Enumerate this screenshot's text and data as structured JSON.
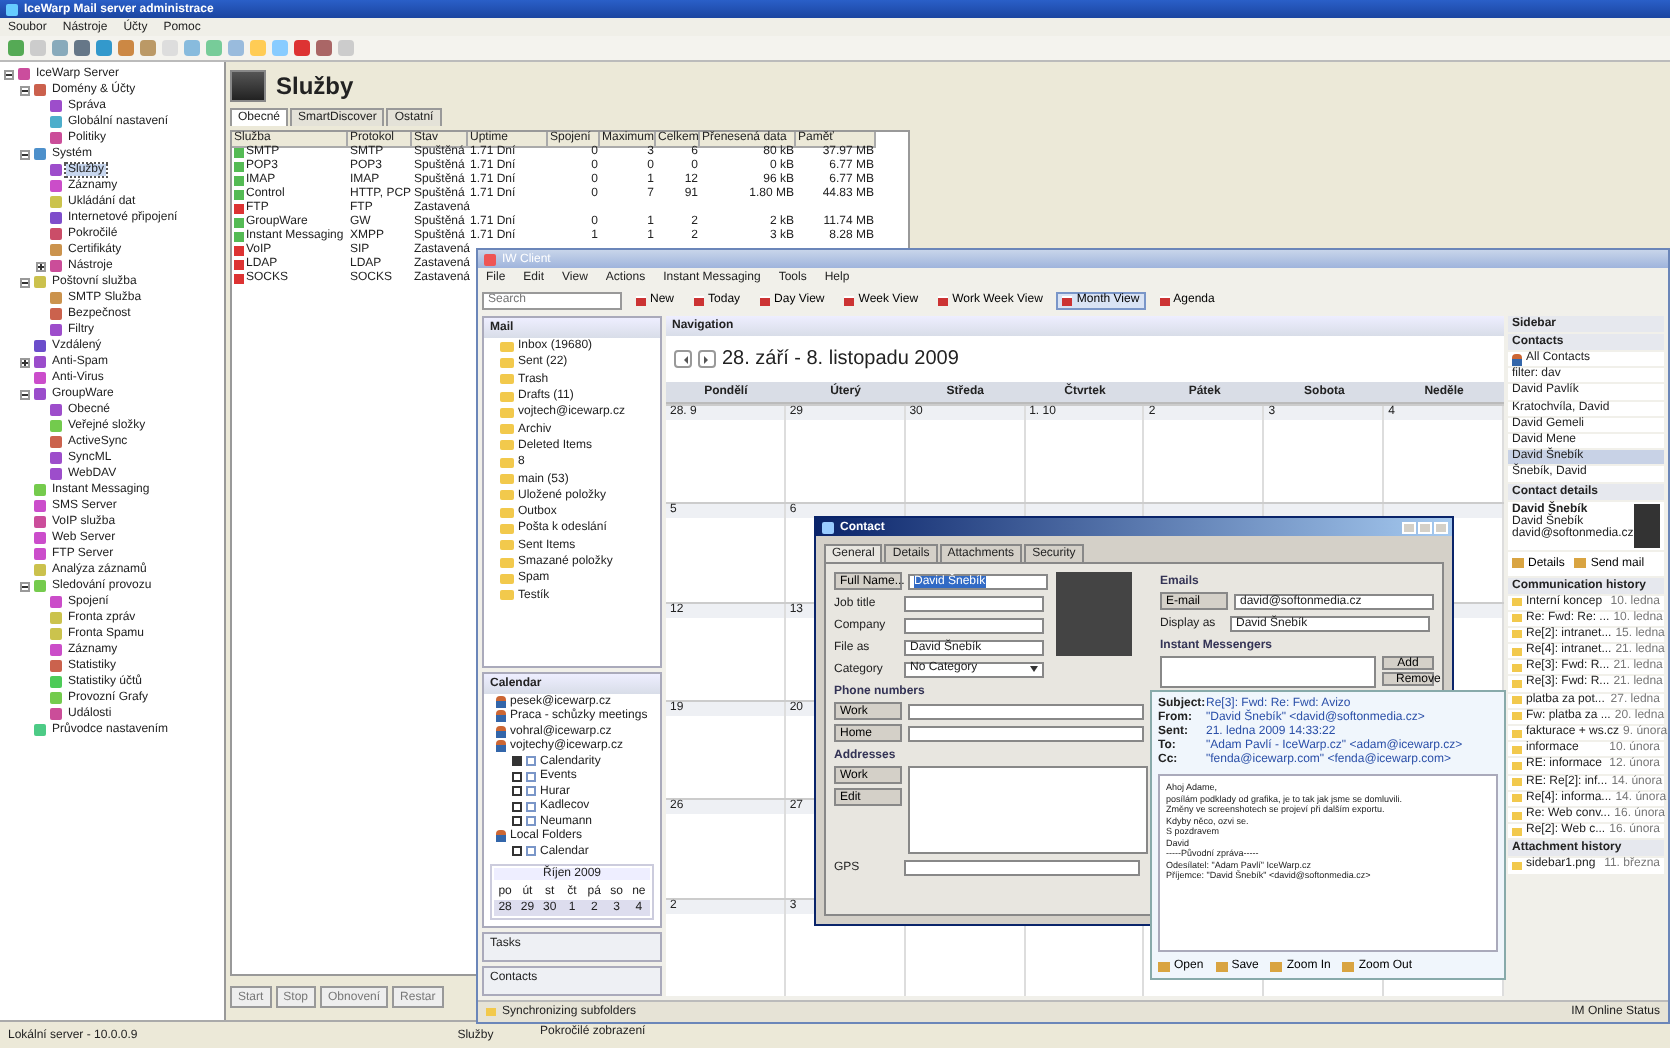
{
  "admin": {
    "title": "IceWarp Mail server administrace",
    "menu": [
      "Soubor",
      "Nástroje",
      "Účty",
      "Pomoc"
    ],
    "tree": [
      {
        "label": "IceWarp Server",
        "selected": false,
        "expanded": true,
        "children": [
          {
            "label": "Domény & Účty",
            "selected": false,
            "expanded": true,
            "children": [
              {
                "label": "Správa",
                "selected": false
              },
              {
                "label": "Globální nastavení",
                "selected": false
              },
              {
                "label": "Politiky",
                "selected": false
              }
            ]
          },
          {
            "label": "Systém",
            "selected": false,
            "expanded": true,
            "children": [
              {
                "label": "Služby",
                "selected": true
              },
              {
                "label": "Záznamy",
                "selected": false
              },
              {
                "label": "Ukládání dat",
                "selected": false
              },
              {
                "label": "Internetové připojení",
                "selected": false
              },
              {
                "label": "Pokročilé",
                "selected": false
              },
              {
                "label": "Certifikáty",
                "selected": false
              },
              {
                "label": "Nástroje",
                "selected": false,
                "expanded": false
              }
            ]
          },
          {
            "label": "Poštovní služba",
            "selected": false,
            "expanded": true,
            "children": [
              {
                "label": "SMTP Služba",
                "selected": false
              },
              {
                "label": "Bezpečnost",
                "selected": false
              },
              {
                "label": "Filtry",
                "selected": false
              }
            ]
          },
          {
            "label": "Vzdálený",
            "selected": false
          },
          {
            "label": "Anti-Spam",
            "selected": false,
            "expanded": false
          },
          {
            "label": "Anti-Virus",
            "selected": false
          },
          {
            "label": "GroupWare",
            "selected": false,
            "expanded": true,
            "children": [
              {
                "label": "Obecné",
                "selected": false
              },
              {
                "label": "Veřejné složky",
                "selected": false
              },
              {
                "label": "ActiveSync",
                "selected": false
              },
              {
                "label": "SyncML",
                "selected": false
              },
              {
                "label": "WebDAV",
                "selected": false
              }
            ]
          },
          {
            "label": "Instant Messaging",
            "selected": false
          },
          {
            "label": "SMS Server",
            "selected": false
          },
          {
            "label": "VoIP služba",
            "selected": false
          },
          {
            "label": "Web Server",
            "selected": false
          },
          {
            "label": "FTP Server",
            "selected": false
          },
          {
            "label": "Analýza záznamů",
            "selected": false
          },
          {
            "label": "Sledování provozu",
            "selected": false,
            "expanded": true,
            "children": [
              {
                "label": "Spojení",
                "selected": false
              },
              {
                "label": "Fronta zpráv",
                "selected": false
              },
              {
                "label": "Fronta Spamu",
                "selected": false
              },
              {
                "label": "Záznamy",
                "selected": false
              },
              {
                "label": "Statistiky",
                "selected": false
              },
              {
                "label": "Statistiky účtů",
                "selected": false
              },
              {
                "label": "Provozní Grafy",
                "selected": false
              },
              {
                "label": "Události",
                "selected": false
              }
            ]
          },
          {
            "label": "Průvodce nastavením",
            "selected": false
          }
        ]
      }
    ],
    "header": "Služby",
    "tabs": [
      {
        "label": "Obecné",
        "selected": true
      },
      {
        "label": "SmartDiscover",
        "selected": false
      },
      {
        "label": "Ostatní",
        "selected": false
      }
    ],
    "table": {
      "columns": [
        "Služba",
        "Protokol",
        "Stav",
        "Uptime",
        "Spojení",
        "Maximum",
        "Celkem",
        "Přenesená data",
        "Paměť"
      ],
      "rows": [
        {
          "running": true,
          "cells": [
            "SMTP",
            "SMTP",
            "Spuštěná",
            "1.71 Dní",
            "0",
            "3",
            "6",
            "80 kB",
            "37.97 MB"
          ]
        },
        {
          "running": true,
          "cells": [
            "POP3",
            "POP3",
            "Spuštěná",
            "1.71 Dní",
            "0",
            "0",
            "0",
            "0 kB",
            "6.77 MB"
          ]
        },
        {
          "running": true,
          "cells": [
            "IMAP",
            "IMAP",
            "Spuštěná",
            "1.71 Dní",
            "0",
            "1",
            "12",
            "96 kB",
            "6.77 MB"
          ]
        },
        {
          "running": true,
          "cells": [
            "Control",
            "HTTP, PCP",
            "Spuštěná",
            "1.71 Dní",
            "0",
            "7",
            "91",
            "1.80 MB",
            "44.83 MB"
          ]
        },
        {
          "running": false,
          "cells": [
            "FTP",
            "FTP",
            "Zastavená"
          ]
        },
        {
          "running": true,
          "cells": [
            "GroupWare",
            "GW",
            "Spuštěná",
            "1.71 Dní",
            "0",
            "1",
            "2",
            "2 kB",
            "11.74 MB"
          ]
        },
        {
          "running": true,
          "cells": [
            "Instant Messaging",
            "XMPP",
            "Spuštěná",
            "1.71 Dní",
            "1",
            "1",
            "2",
            "3 kB",
            "8.28 MB"
          ]
        },
        {
          "running": false,
          "cells": [
            "VoIP",
            "SIP",
            "Zastavená"
          ]
        },
        {
          "running": false,
          "cells": [
            "LDAP",
            "LDAP",
            "Zastavená"
          ]
        },
        {
          "running": false,
          "cells": [
            "SOCKS",
            "SOCKS",
            "Zastavená"
          ]
        }
      ]
    },
    "buttons": [
      "Start",
      "Stop",
      "Obnovení",
      "Restar"
    ],
    "status_bar": [
      "Lokální server - 10.0.0.9",
      "Služby"
    ]
  },
  "client": {
    "title": "IW Client",
    "menu": [
      "File",
      "Edit",
      "View",
      "Actions",
      "Instant Messaging",
      "Tools",
      "Help"
    ],
    "search": {
      "placeholder": "Search"
    },
    "toolbar": [
      {
        "label": "New",
        "selected": false
      },
      {
        "label": "Today",
        "selected": false
      },
      {
        "label": "Day View",
        "selected": false
      },
      {
        "label": "Week View",
        "selected": false
      },
      {
        "label": "Work Week View",
        "selected": false
      },
      {
        "label": "Month View",
        "selected": true
      },
      {
        "label": "Agenda",
        "selected": false
      }
    ],
    "mail": {
      "title": "Mail",
      "folders": [
        "Inbox (19680)",
        "Sent (22)",
        "Trash",
        "Drafts (11)",
        "vojtech@icewarp.cz",
        "Archiv",
        "Deleted Items",
        "8",
        "main (53)",
        "Uložené položky",
        "Outbox",
        "Pošta k odeslání",
        "Sent Items",
        "Smazané položky",
        "Spam",
        "Testík"
      ]
    },
    "calendar": {
      "title": "Calendar",
      "items": [
        {
          "kind": "account",
          "label": "pesek@icewarp.cz"
        },
        {
          "kind": "account",
          "label": "Praca - schůzky meetings"
        },
        {
          "kind": "account",
          "label": "vohral@icewarp.cz"
        },
        {
          "kind": "account",
          "label": "vojtechy@icewarp.cz"
        },
        {
          "kind": "calendar",
          "label": "Calendarity",
          "checked": true
        },
        {
          "kind": "calendar",
          "label": "Events",
          "checked": false
        },
        {
          "kind": "calendar",
          "label": "Hurar",
          "checked": false
        },
        {
          "kind": "calendar",
          "label": "Kadlecov",
          "checked": false
        },
        {
          "kind": "calendar",
          "label": "Neumann",
          "checked": false
        },
        {
          "kind": "account",
          "label": "Local Folders"
        },
        {
          "kind": "calendar",
          "label": "Calendar",
          "checked": false
        }
      ],
      "month": "Říjen 2009",
      "weekdays": [
        "po",
        "út",
        "st",
        "čt",
        "pá",
        "so",
        "ne"
      ],
      "days": [
        "28",
        "29",
        "30",
        "1",
        "2",
        "3",
        "4"
      ]
    },
    "panes": [
      "Tasks",
      "Contacts"
    ],
    "status": "Synchronizing subfolders",
    "status_right": "IM Online Status",
    "bottom_note": "Pokročilé zobrazení",
    "navigation": {
      "title": "Navigation",
      "range": "28. září - 8. listopadu 2009",
      "weekdays": [
        "Pondělí",
        "Úterý",
        "Středa",
        "Čtvrtek",
        "Pátek",
        "Sobota",
        "Neděle"
      ],
      "weeks": [
        [
          "28. 9",
          "29",
          "30",
          "1. 10",
          "2",
          "3",
          "4"
        ],
        [
          "5",
          "6"
        ],
        [
          "12",
          "13"
        ],
        [
          "19",
          "20"
        ],
        [
          "26",
          "27"
        ],
        [
          "2",
          "3"
        ]
      ]
    },
    "sidebar": {
      "title": "Sidebar",
      "contacts_title": "Contacts",
      "all_contacts": "All Contacts",
      "filter": "filter: dav",
      "contacts": [
        {
          "label": "David Pavlík",
          "selected": false
        },
        {
          "label": "Kratochvíla, David",
          "selected": false
        },
        {
          "label": "David Gemeli",
          "selected": false
        },
        {
          "label": "David Mene",
          "selected": false
        },
        {
          "label": "David Šnebík",
          "selected": true
        },
        {
          "label": "Šnebík, David",
          "selected": false
        }
      ],
      "details_title": "Contact details",
      "details": [
        "David Šnebík",
        "David Šnebík",
        "david@softonmedia.cz"
      ],
      "detail_buttons": [
        "Details",
        "Send mail"
      ],
      "history_title": "Communication history",
      "history": [
        [
          "Interní koncep",
          "10. ledna"
        ],
        [
          "Re: Fwd: Re: ...",
          "10. ledna"
        ],
        [
          "Re[2]: intranet...",
          "15. ledna"
        ],
        [
          "Re[4]: intranet...",
          "21. ledna"
        ],
        [
          "Re[3]: Fwd: R...",
          "21. ledna"
        ],
        [
          "Re[3]: Fwd: R...",
          "21. ledna"
        ],
        [
          "platba za pot...",
          "27. ledna"
        ],
        [
          "Fw: platba za ...",
          "20. ledna"
        ],
        [
          "fakturace + ws.cz",
          "9. února"
        ],
        [
          "informace",
          "10. února"
        ],
        [
          "RE: informace",
          "12. února"
        ],
        [
          "RE: Re[2]: inf...",
          "14. února"
        ],
        [
          "Re[4]: informa...",
          "14. února"
        ],
        [
          "Re: Web conv...",
          "16. února"
        ],
        [
          "Re[2]: Web c...",
          "16. února"
        ]
      ],
      "attachments_title": "Attachment history",
      "attachments": [
        [
          "sidebar1.png",
          "11. března"
        ]
      ]
    }
  },
  "contact": {
    "title": "Contact",
    "tabs": [
      {
        "label": "General",
        "selected": true
      },
      {
        "label": "Details",
        "selected": false
      },
      {
        "label": "Attachments",
        "selected": false
      },
      {
        "label": "Security",
        "selected": false
      }
    ],
    "fields": [
      {
        "kind": "button",
        "label": "Full Name...",
        "value": "David Šnebík"
      },
      {
        "kind": "text",
        "label": "Job title"
      },
      {
        "kind": "text",
        "label": "Company"
      },
      {
        "kind": "text",
        "label": "File as",
        "value": "David Šnebík"
      },
      {
        "kind": "select",
        "label": "Category",
        "value": "No Category"
      }
    ],
    "phone_title": "Phone numbers",
    "phones": [
      "Work",
      "Home"
    ],
    "address_title": "Addresses",
    "address_buttons": [
      "Work",
      "Edit"
    ],
    "gps": "GPS",
    "emails_title": "Emails",
    "email_button": "E-mail",
    "email": "david@softonmedia.cz",
    "display_label": "Display as",
    "display": "David Šnebík",
    "im_title": "Instant Messengers",
    "im_buttons": [
      "Add",
      "Remove"
    ]
  },
  "preview": {
    "headers": [
      [
        "Subject:",
        "Re[3]: Fwd: Re: Fwd: Avizo"
      ],
      [
        "From:",
        "\"David Šnebík\" <david@softonmedia.cz>"
      ],
      [
        "Sent:",
        "21. ledna 2009 14:33:22"
      ],
      [
        "To:",
        "\"Adam Pavlí - IceWarp.cz\" <adam@icewarp.cz>"
      ],
      [
        "Cc:",
        "\"fenda@icewarp.com\" <fenda@icewarp.com>"
      ]
    ],
    "body": [
      "Ahoj Adame,",
      "posílám podklady od grafika, je to tak jak jsme se domluvili.",
      "Změny ve screenshotech se projeví při dalším exportu.",
      "Kdyby něco, ozvi se.",
      "S pozdravem",
      "David",
      "-----Původní zpráva-----",
      "Odesílatel: \"Adam Pavlí\" IceWarp.cz",
      "Příjemce: \"David Šnebík\" <david@softonmedia.cz>"
    ],
    "buttons": [
      "Open",
      "Save",
      "Zoom In",
      "Zoom Out"
    ]
  }
}
